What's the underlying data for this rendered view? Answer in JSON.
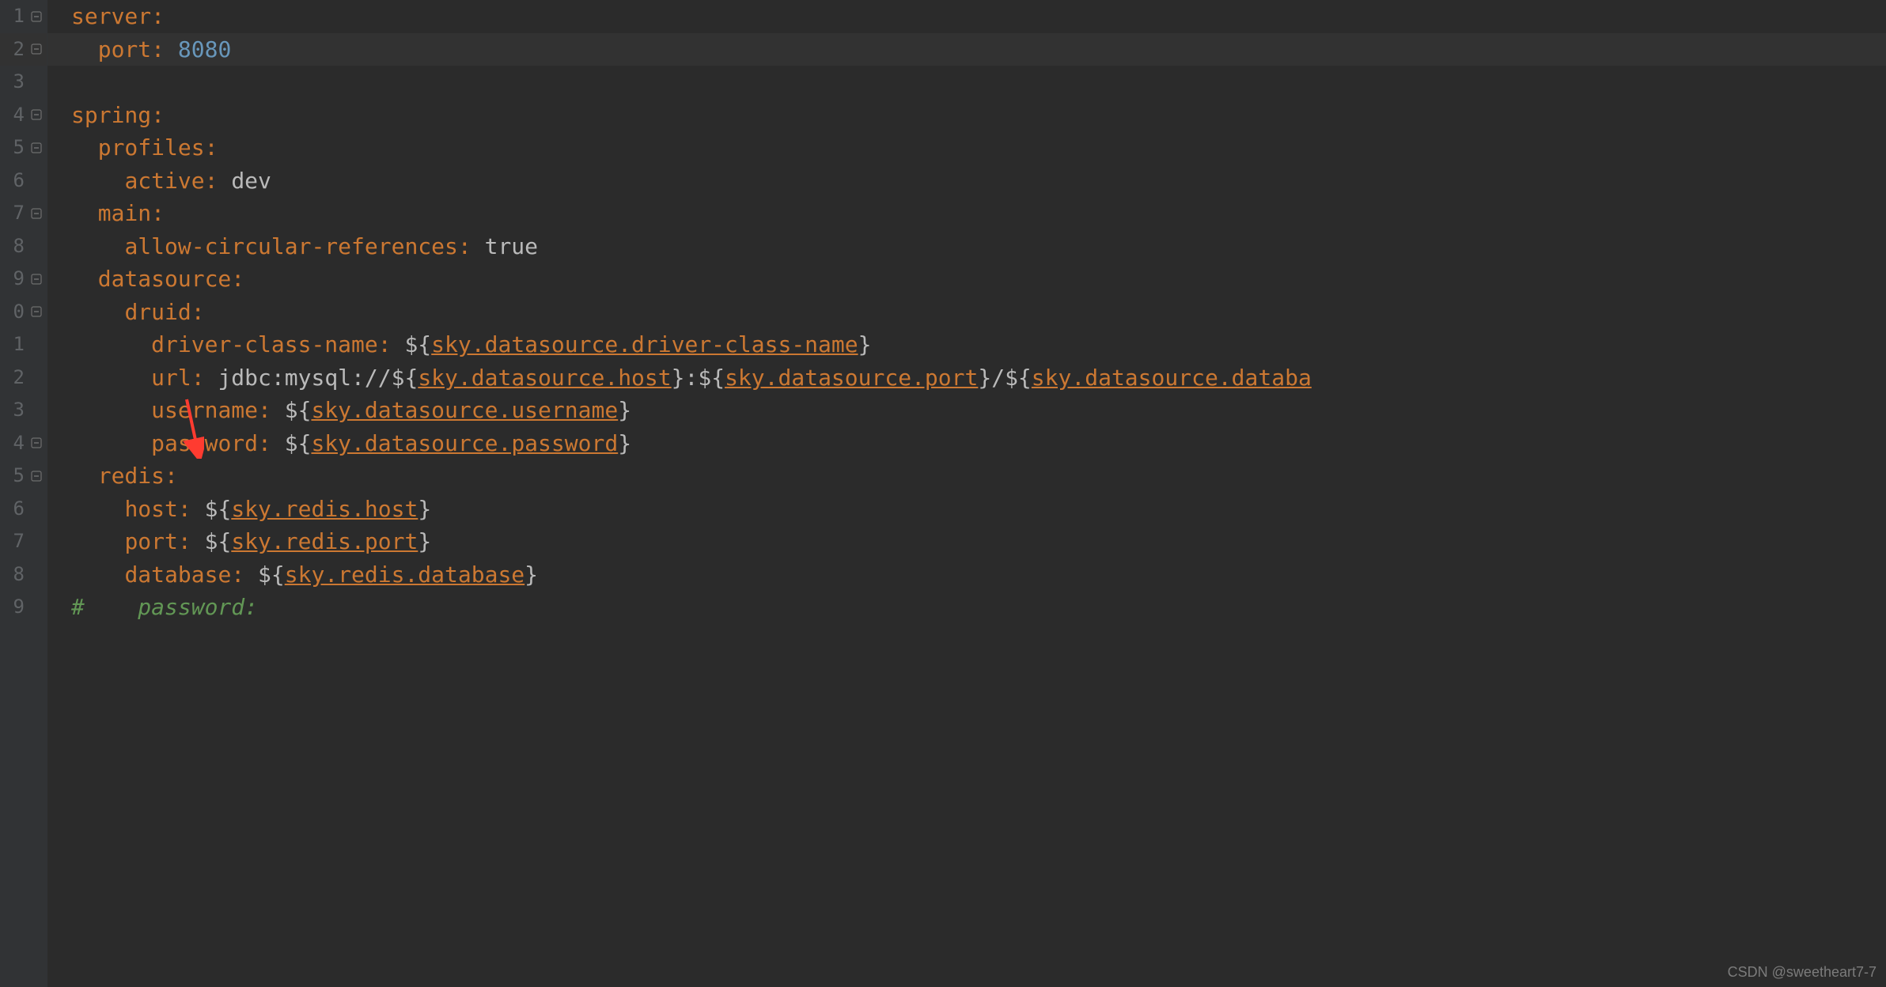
{
  "watermark": "CSDN @sweetheart7-7",
  "lines": [
    {
      "n": "1",
      "fold": "minus",
      "tokens": [
        {
          "t": "key",
          "v": "server"
        },
        {
          "t": "colon",
          "v": ":"
        }
      ]
    },
    {
      "n": "2",
      "fold": "minus",
      "highlight": true,
      "tokens": [
        {
          "t": "plain",
          "v": "  "
        },
        {
          "t": "key",
          "v": "port"
        },
        {
          "t": "colon",
          "v": ": "
        },
        {
          "t": "value-num",
          "v": "8080"
        }
      ]
    },
    {
      "n": "3",
      "fold": "",
      "tokens": []
    },
    {
      "n": "4",
      "fold": "minus",
      "tokens": [
        {
          "t": "key",
          "v": "spring"
        },
        {
          "t": "colon",
          "v": ":"
        }
      ]
    },
    {
      "n": "5",
      "fold": "minus",
      "tokens": [
        {
          "t": "plain",
          "v": "  "
        },
        {
          "t": "key",
          "v": "profiles"
        },
        {
          "t": "colon",
          "v": ":"
        }
      ]
    },
    {
      "n": "6",
      "fold": "",
      "tokens": [
        {
          "t": "plain",
          "v": "    "
        },
        {
          "t": "key",
          "v": "active"
        },
        {
          "t": "colon",
          "v": ": "
        },
        {
          "t": "value-text",
          "v": "dev"
        }
      ]
    },
    {
      "n": "7",
      "fold": "minus",
      "tokens": [
        {
          "t": "plain",
          "v": "  "
        },
        {
          "t": "key",
          "v": "main"
        },
        {
          "t": "colon",
          "v": ":"
        }
      ]
    },
    {
      "n": "8",
      "fold": "",
      "tokens": [
        {
          "t": "plain",
          "v": "    "
        },
        {
          "t": "key",
          "v": "allow-circular-references"
        },
        {
          "t": "colon",
          "v": ": "
        },
        {
          "t": "value-text",
          "v": "true"
        }
      ]
    },
    {
      "n": "9",
      "fold": "minus",
      "tokens": [
        {
          "t": "plain",
          "v": "  "
        },
        {
          "t": "key",
          "v": "datasource"
        },
        {
          "t": "colon",
          "v": ":"
        }
      ]
    },
    {
      "n": "0",
      "fold": "minus",
      "tokens": [
        {
          "t": "plain",
          "v": "    "
        },
        {
          "t": "key",
          "v": "druid"
        },
        {
          "t": "colon",
          "v": ":"
        }
      ]
    },
    {
      "n": "1",
      "fold": "",
      "tokens": [
        {
          "t": "plain",
          "v": "      "
        },
        {
          "t": "key",
          "v": "driver-class-name"
        },
        {
          "t": "colon",
          "v": ": "
        },
        {
          "t": "dollar",
          "v": "${"
        },
        {
          "t": "ref",
          "v": "sky.datasource.driver-class-name"
        },
        {
          "t": "dollar",
          "v": "}"
        }
      ]
    },
    {
      "n": "2",
      "fold": "",
      "tokens": [
        {
          "t": "plain",
          "v": "      "
        },
        {
          "t": "key",
          "v": "url"
        },
        {
          "t": "colon",
          "v": ": "
        },
        {
          "t": "value-text",
          "v": "jdbc:mysql://"
        },
        {
          "t": "dollar",
          "v": "${"
        },
        {
          "t": "ref",
          "v": "sky.datasource.host"
        },
        {
          "t": "dollar",
          "v": "}"
        },
        {
          "t": "value-text",
          "v": ":"
        },
        {
          "t": "dollar",
          "v": "${"
        },
        {
          "t": "ref",
          "v": "sky.datasource.port"
        },
        {
          "t": "dollar",
          "v": "}"
        },
        {
          "t": "value-text",
          "v": "/"
        },
        {
          "t": "dollar",
          "v": "${"
        },
        {
          "t": "ref",
          "v": "sky.datasource.databa"
        }
      ]
    },
    {
      "n": "3",
      "fold": "",
      "tokens": [
        {
          "t": "plain",
          "v": "      "
        },
        {
          "t": "key",
          "v": "username"
        },
        {
          "t": "colon",
          "v": ": "
        },
        {
          "t": "dollar",
          "v": "${"
        },
        {
          "t": "ref",
          "v": "sky.datasource.username"
        },
        {
          "t": "dollar",
          "v": "}"
        }
      ]
    },
    {
      "n": "4",
      "fold": "minus",
      "tokens": [
        {
          "t": "plain",
          "v": "      "
        },
        {
          "t": "key",
          "v": "password"
        },
        {
          "t": "colon",
          "v": ": "
        },
        {
          "t": "dollar",
          "v": "${"
        },
        {
          "t": "ref",
          "v": "sky.datasource.password"
        },
        {
          "t": "dollar",
          "v": "}"
        }
      ]
    },
    {
      "n": "5",
      "fold": "minus",
      "tokens": [
        {
          "t": "plain",
          "v": "  "
        },
        {
          "t": "key",
          "v": "redis"
        },
        {
          "t": "colon",
          "v": ":"
        }
      ]
    },
    {
      "n": "6",
      "fold": "",
      "tokens": [
        {
          "t": "plain",
          "v": "    "
        },
        {
          "t": "key",
          "v": "host"
        },
        {
          "t": "colon",
          "v": ": "
        },
        {
          "t": "dollar",
          "v": "${"
        },
        {
          "t": "ref",
          "v": "sky.redis.host"
        },
        {
          "t": "dollar",
          "v": "}"
        }
      ]
    },
    {
      "n": "7",
      "fold": "",
      "tokens": [
        {
          "t": "plain",
          "v": "    "
        },
        {
          "t": "key",
          "v": "port"
        },
        {
          "t": "colon",
          "v": ": "
        },
        {
          "t": "dollar",
          "v": "${"
        },
        {
          "t": "ref",
          "v": "sky.redis.port"
        },
        {
          "t": "dollar",
          "v": "}"
        }
      ]
    },
    {
      "n": "8",
      "fold": "",
      "tokens": [
        {
          "t": "plain",
          "v": "    "
        },
        {
          "t": "key",
          "v": "database"
        },
        {
          "t": "colon",
          "v": ": "
        },
        {
          "t": "dollar",
          "v": "${"
        },
        {
          "t": "ref",
          "v": "sky.redis.database"
        },
        {
          "t": "dollar",
          "v": "}"
        }
      ]
    },
    {
      "n": "9",
      "fold": "",
      "tokens": [
        {
          "t": "comment",
          "v": "#    password:"
        }
      ]
    }
  ]
}
